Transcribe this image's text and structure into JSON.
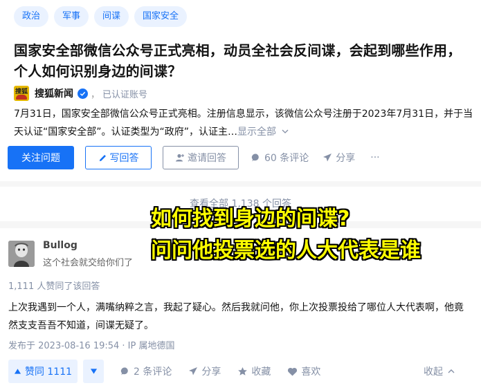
{
  "topics": [
    "政治",
    "军事",
    "间谍",
    "国家安全"
  ],
  "question": {
    "title": "国家安全部微信公众号正式亮相，动员全社会反间谍，会起到哪些作用，个人如何识别身边的间谍？",
    "author": {
      "logo_text": "搜狐",
      "name": "搜狐新闻",
      "separator": "，",
      "verified_text": "已认证账号"
    },
    "excerpt": "7月31日，国家安全部微信公众号正式亮相。注册信息显示，该微信公众号注册于2023年7月31日，并于当天认证“国家安全部”。认证类型为“政府”，认证主…",
    "show_all": "显示全部",
    "actions": {
      "follow": "关注问题",
      "write": "写回答",
      "invite": "邀请回答",
      "comments": "60 条评论",
      "share": "分享",
      "more": "···"
    }
  },
  "view_all": "查看全部 1,138 个回答",
  "overlay": {
    "line1": "如何找到身边的间谍?",
    "line2": "问问他投票选的人大代表是谁"
  },
  "answer": {
    "author_name": "Bullog",
    "author_bio": "这个社会就交给你们了",
    "votes_text": "1,111 人赞同了该回答",
    "body": "上次我遇到一个人，满嘴纳粹之言，我起了疑心。然后我就问他，你上次投票投给了哪位人大代表啊，他竟然支支吾吾不知道，间谍无疑了。",
    "time": "发布于 2023-08-16 19:54 · IP 属地德国",
    "actions": {
      "upvote": "赞同 1111",
      "comments": "2 条评论",
      "share": "分享",
      "favorite": "收藏",
      "like": "喜欢",
      "collapse": "收起"
    }
  },
  "colors": {
    "brand": "#1772f6",
    "muted": "#8590a6",
    "overlay": "#ffff00"
  }
}
